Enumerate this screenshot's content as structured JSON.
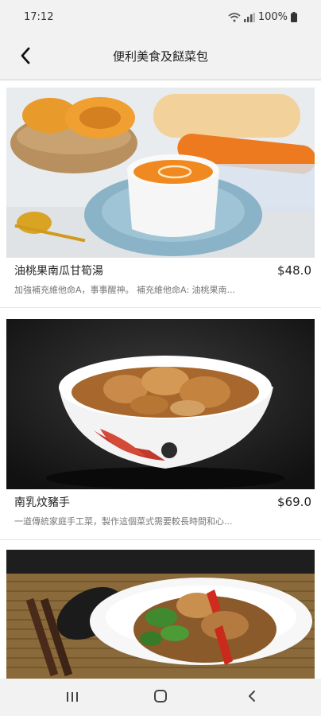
{
  "status_bar": {
    "time": "17:12",
    "battery": "100%"
  },
  "header": {
    "title": "便利美食及餸菜包"
  },
  "items": [
    {
      "name": "油桃果南瓜甘筍湯",
      "price": "$48.0",
      "description": "加強補充維他命A，事事醒神。 補充維他命A: 油桃果南..."
    },
    {
      "name": "南乳炆豬手",
      "price": "$69.0",
      "description": "一道傳統家庭手工菜，製作這個菜式需要較長時間和心..."
    },
    {
      "name": "",
      "price": "",
      "description": ""
    }
  ],
  "colors": {
    "background": "#ffffff",
    "bar": "#f2f2f2",
    "text": "#222222",
    "subtext": "#777777"
  },
  "icons": {
    "back": "chevron-left-icon",
    "wifi": "wifi-icon",
    "signal": "signal-icon",
    "battery": "battery-icon",
    "nav_recents": "recents-icon",
    "nav_home": "home-icon",
    "nav_back": "back-icon"
  }
}
